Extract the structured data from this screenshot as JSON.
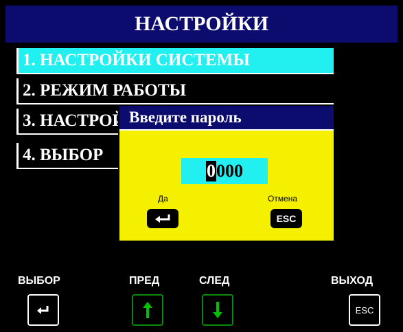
{
  "screen": {
    "title": "НАСТРОЙКИ"
  },
  "menu": {
    "items": [
      {
        "label": "1. НАСТРОЙКИ СИСТЕМЫ",
        "selected": true
      },
      {
        "label": "2. РЕЖИМ РАБОТЫ",
        "selected": false
      },
      {
        "label": "3. НАСТРОЙКИ",
        "selected": false
      },
      {
        "label": "4. ВЫБОР",
        "selected": false
      }
    ]
  },
  "dialog": {
    "title": "Введите пароль",
    "password_cursor_digit": "0",
    "password_rest": "000",
    "confirm_label": "Да",
    "cancel_label": "Отмена",
    "cancel_key_text": "ESC"
  },
  "bottom_bar": {
    "select_label": "ВЫБОР",
    "prev_label": "ПРЕД",
    "next_label": "СЛЕД",
    "exit_label": "ВЫХОД",
    "exit_key_text": "ESC"
  },
  "colors": {
    "title_bg": "#0c0c6e",
    "selected_bg": "#22f0f0",
    "dialog_bg": "#f4f000",
    "nav_key_border": "#0a8a0a",
    "nav_arrow": "#00c000"
  },
  "icons": {
    "enter": "enter-arrow-icon",
    "up": "arrow-up-icon",
    "down": "arrow-down-icon",
    "esc": "esc-icon"
  }
}
